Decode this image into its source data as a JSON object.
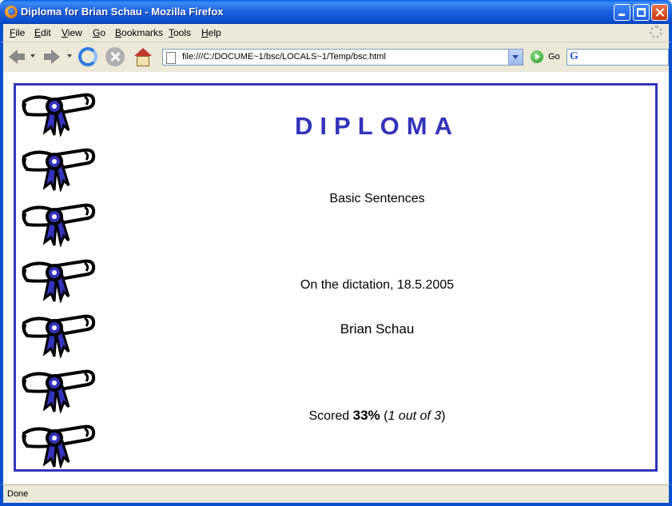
{
  "window": {
    "title": "Diploma for Brian Schau - Mozilla Firefox"
  },
  "menu": [
    {
      "accel": "F",
      "rest": "ile"
    },
    {
      "accel": "E",
      "rest": "dit"
    },
    {
      "accel": "V",
      "rest": "iew"
    },
    {
      "accel": "G",
      "rest": "o"
    },
    {
      "accel": "B",
      "rest": "ookmarks"
    },
    {
      "accel": "T",
      "rest": "ools"
    },
    {
      "accel": "H",
      "rest": "elp"
    }
  ],
  "toolbar": {
    "url": "file:///C:/DOCUME~1/bsc/LOCALS~1/Temp/bsc.html",
    "go_label": "Go",
    "search_value": ""
  },
  "diploma": {
    "title": "DIPLOMA",
    "subject": "Basic Sentences",
    "dictation": "On the dictation, 18.5.2005",
    "name": "Brian Schau",
    "score_prefix": "Scored ",
    "score_percent": "33%",
    "score_open": " (",
    "score_fraction": "1 out of 3",
    "score_close": ")",
    "accent_color": "#3333bb",
    "ribbon_count": 7
  },
  "status": {
    "text": "Done"
  }
}
